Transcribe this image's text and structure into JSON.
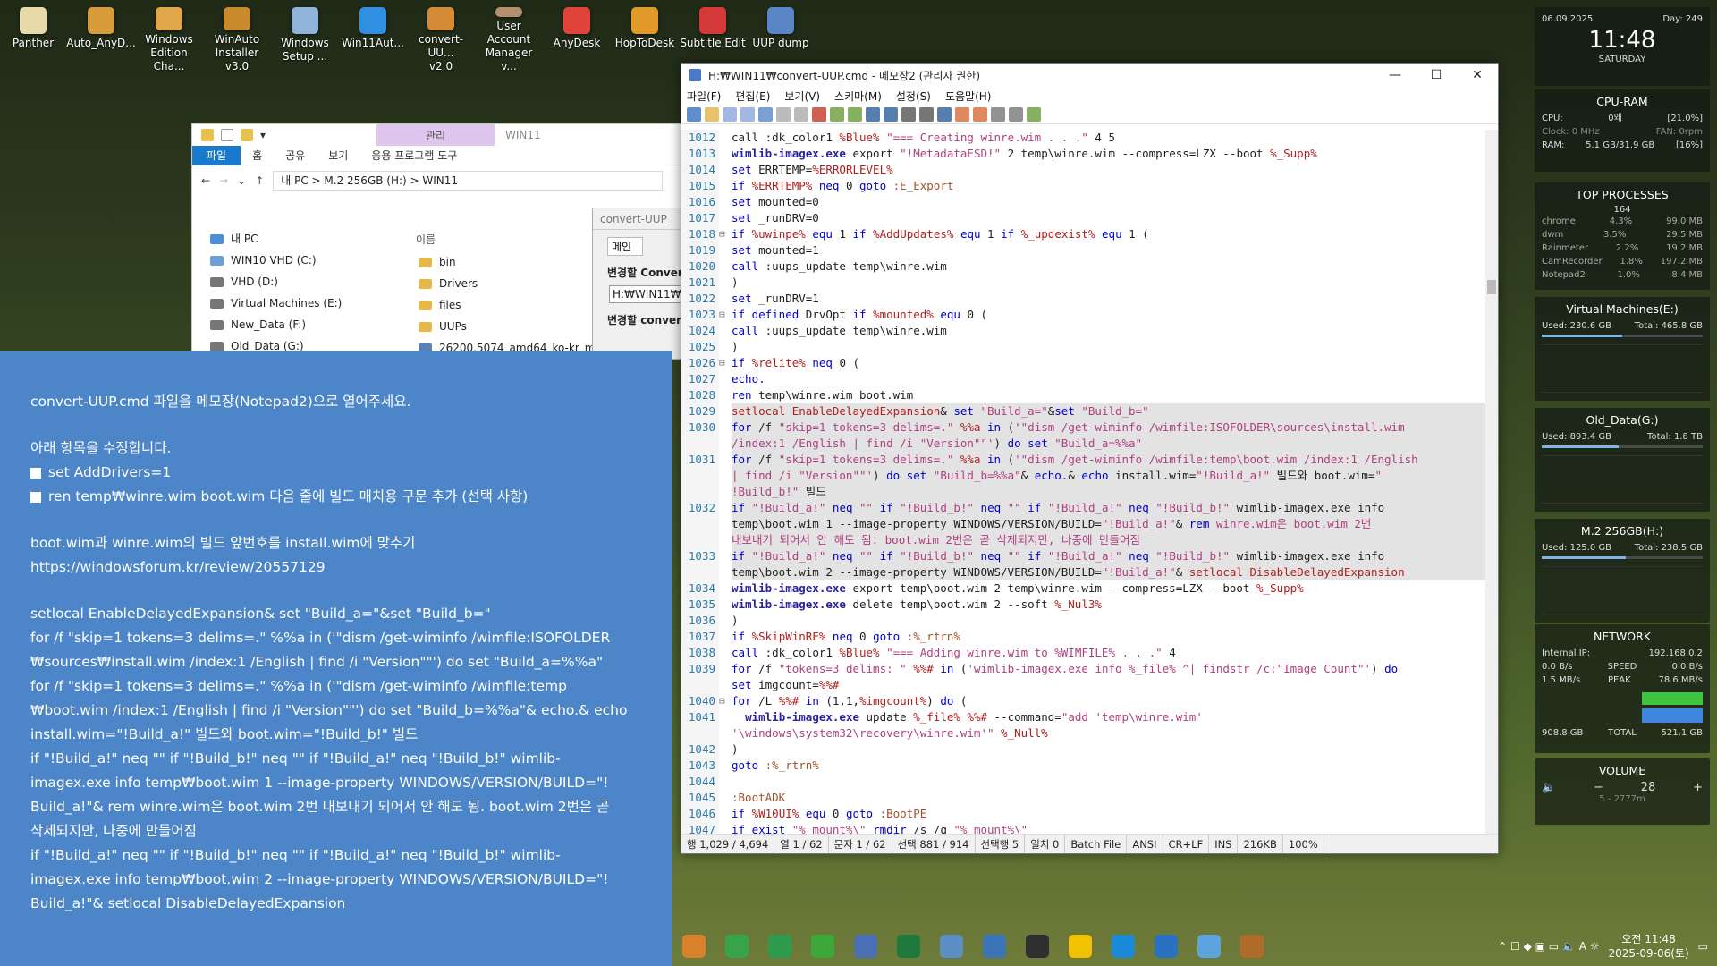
{
  "desktop_icons": [
    {
      "label": "Panther",
      "color": "#e8d9a8"
    },
    {
      "label": "Auto_AnyD...",
      "color": "#d79b3a"
    },
    {
      "label": "Windows\nEdition Cha...",
      "color": "#e0a64a"
    },
    {
      "label": "WinAuto\nInstaller v3.0",
      "color": "#c98a2e"
    },
    {
      "label": "Windows\nSetup ...",
      "color": "#8fb4d8"
    },
    {
      "label": "Win11Aut...",
      "color": "#2f8fe0"
    },
    {
      "label": "convert-UU...\nv2.0",
      "color": "#d58a35"
    },
    {
      "label": "User Account\nManager v...",
      "color": "#b58e6e"
    },
    {
      "label": "AnyDesk",
      "color": "#e0443b"
    },
    {
      "label": "HopToDesk",
      "color": "#e19a2a"
    },
    {
      "label": "Subtitle Edit",
      "color": "#d53a3a"
    },
    {
      "label": "UUP dump",
      "color": "#5a86c8"
    }
  ],
  "explorer": {
    "ribbon_context": "관리",
    "window_label": "WIN11",
    "tabs": [
      "파일",
      "홈",
      "공유",
      "보기",
      "응용 프로그램 도구"
    ],
    "path": [
      "내 PC",
      "M.2 256GB (H:)",
      "WIN11"
    ],
    "nav": [
      {
        "label": "내 PC",
        "color": "#4a90d9"
      },
      {
        "label": "WIN10 VHD (C:)",
        "color": "#6a9fd8"
      },
      {
        "label": "VHD (D:)",
        "color": "#777"
      },
      {
        "label": "Virtual Machines (E:)",
        "color": "#777"
      },
      {
        "label": "New_Data (F:)",
        "color": "#777"
      },
      {
        "label": "Old_Data (G:)",
        "color": "#777"
      }
    ],
    "column_header": "이름",
    "files": [
      {
        "label": "bin",
        "color": "#e6b84a"
      },
      {
        "label": "Drivers",
        "color": "#e6b84a"
      },
      {
        "label": "files",
        "color": "#e6b84a"
      },
      {
        "label": "UUPs",
        "color": "#e6b84a"
      },
      {
        "label": "26200.5074_amd64_ko-kr_multi",
        "color": "#5b7fb8"
      }
    ]
  },
  "convert_dialog": {
    "title": "convert-UUP_",
    "tab": "메인",
    "label1": "변경할 Conver",
    "field": "H:₩WIN11₩",
    "label2": "변경할 conver"
  },
  "notepad": {
    "title": "H:₩WIN11₩convert-UUP.cmd - 메모장2 (관리자 권한)",
    "menu": [
      "파일(F)",
      "편집(E)",
      "보기(V)",
      "스키마(M)",
      "설정(S)",
      "도움말(H)"
    ],
    "lines": [
      {
        "n": "1012",
        "html": "call :dk_color1 <span class=var>%Blue%</span> <span class=str>\"=== Creating winre.wim . . .\"</span> 4 5"
      },
      {
        "n": "1013",
        "html": "<span class=cmd>wimlib-imagex.exe</span> export <span class=str>\"!MetadataESD!\"</span> 2 temp\\winre.wim --compress=LZX --boot <span class=var>%_Supp%</span>"
      },
      {
        "n": "1014",
        "html": "<span class=kw>set</span> ERRTEMP=<span class=var>%ERRORLEVEL%</span>"
      },
      {
        "n": "1015",
        "html": "<span class=kw>if</span> <span class=var>%ERRTEMP%</span> <span class=kw>neq</span> 0 <span class=kw>goto</span> <span class=lbl>:E_Export</span>"
      },
      {
        "n": "1016",
        "html": "<span class=kw>set</span> mounted=0"
      },
      {
        "n": "1017",
        "html": "<span class=kw>set</span> _runDRV=0"
      },
      {
        "n": "1018",
        "fold": "⊟",
        "html": "<span class=kw>if</span> <span class=var>%uwinpe%</span> <span class=kw>equ</span> 1 <span class=kw>if</span> <span class=var>%AddUpdates%</span> <span class=kw>equ</span> 1 <span class=kw>if</span> <span class=var>%_updexist%</span> <span class=kw>equ</span> 1 ("
      },
      {
        "n": "1019",
        "html": "<span class=kw>set</span> mounted=1"
      },
      {
        "n": "1020",
        "html": "<span class=kw>call</span> :uups_update temp\\winre.wim"
      },
      {
        "n": "1021",
        "html": ")"
      },
      {
        "n": "1022",
        "html": "<span class=kw>set</span> _runDRV=1"
      },
      {
        "n": "1023",
        "fold": "⊟",
        "html": "<span class=kw>if defined</span> DrvOpt <span class=kw>if</span> <span class=var>%mounted%</span> <span class=kw>equ</span> 0 ("
      },
      {
        "n": "1024",
        "html": "<span class=kw>call</span> :uups_update temp\\winre.wim"
      },
      {
        "n": "1025",
        "html": ")"
      },
      {
        "n": "1026",
        "fold": "⊟",
        "html": "<span class=kw>if</span> <span class=var>%relite%</span> <span class=kw>neq</span> 0 ("
      },
      {
        "n": "1027",
        "html": "<span class=kw>echo.</span>"
      },
      {
        "n": "1028",
        "html": "<span class=kw>ren</span> temp\\winre.wim boot.wim"
      },
      {
        "n": "1029",
        "sel": true,
        "html": "<span class=var>setlocal EnableDelayedExpansion</span>&amp; <span class=kw>set</span> <span class=str>\"Build_a=\"</span>&amp;<span class=kw>set</span> <span class=str>\"Build_b=\"</span>"
      },
      {
        "n": "1030",
        "sel": true,
        "html": "<span class=kw>for</span> /f <span class=str>\"skip=1 tokens=3 delims=.\"</span> <span class=var>%%a</span> <span class=kw>in</span> (<span class=str>'\"dism /get-wiminfo /wimfile:ISOFOLDER\\sources\\install.wim</span>"
      },
      {
        "n": "",
        "sel": true,
        "html": "<span class=str>/index:1 /English | find /i \"Version\"\"'</span>) <span class=kw>do set</span> <span class=str>\"Build_a=%%a\"</span>"
      },
      {
        "n": "1031",
        "sel": true,
        "html": "<span class=kw>for</span> /f <span class=str>\"skip=1 tokens=3 delims=.\"</span> <span class=var>%%a</span> <span class=kw>in</span> (<span class=str>'\"dism /get-wiminfo /wimfile:temp\\boot.wim /index:1 /English</span>"
      },
      {
        "n": "",
        "sel": true,
        "html": "<span class=str>| find /i \"Version\"\"'</span>) <span class=kw>do set</span> <span class=str>\"Build_b=%%a\"</span>&amp; <span class=kw>echo.</span>&amp; <span class=kw>echo</span> install.wim=<span class=str>\"!Build_a!\"</span> 빌드와 boot.wim=<span class=str>\"</span>"
      },
      {
        "n": "",
        "sel": true,
        "html": "<span class=str>!Build_b!\"</span> 빌드"
      },
      {
        "n": "1032",
        "sel": true,
        "html": "<span class=kw>if</span> <span class=str>\"!Build_a!\"</span> <span class=kw>neq</span> <span class=str>\"\"</span> <span class=kw>if</span> <span class=str>\"!Build_b!\"</span> <span class=kw>neq</span> <span class=str>\"\"</span> <span class=kw>if</span> <span class=str>\"!Build_a!\"</span> <span class=kw>neq</span> <span class=str>\"!Build_b!\"</span> wimlib-imagex.exe info"
      },
      {
        "n": "",
        "sel": true,
        "html": "temp\\boot.wim 1 --image-property WINDOWS/VERSION/BUILD=<span class=str>\"!Build_a!\"</span>&amp; <span class=kw>rem</span> <span class=str>winre.wim은 boot.wim 2번</span>"
      },
      {
        "n": "",
        "sel": true,
        "html": "<span class=str>내보내기 되어서 안 해도 됨. boot.wim 2번은 곧 삭제되지만, 나중에 만들어짐</span>"
      },
      {
        "n": "1033",
        "sel": true,
        "html": "<span class=kw>if</span> <span class=str>\"!Build_a!\"</span> <span class=kw>neq</span> <span class=str>\"\"</span> <span class=kw>if</span> <span class=str>\"!Build_b!\"</span> <span class=kw>neq</span> <span class=str>\"\"</span> <span class=kw>if</span> <span class=str>\"!Build_a!\"</span> <span class=kw>neq</span> <span class=str>\"!Build_b!\"</span> wimlib-imagex.exe info"
      },
      {
        "n": "",
        "sel": true,
        "html": "temp\\boot.wim 2 --image-property WINDOWS/VERSION/BUILD=<span class=str>\"!Build_a!\"</span>&amp; <span class=var>setlocal DisableDelayedExpansion</span>"
      },
      {
        "n": "1034",
        "html": "<span class=cmd>wimlib-imagex.exe</span> export temp\\boot.wim 2 temp\\winre.wim --compress=LZX --boot <span class=var>%_Supp%</span>"
      },
      {
        "n": "1035",
        "html": "<span class=cmd>wimlib-imagex.exe</span> delete temp\\boot.wim 2 --soft <span class=var>%_Nul3%</span>"
      },
      {
        "n": "1036",
        "html": ")"
      },
      {
        "n": "1037",
        "html": "<span class=kw>if</span> <span class=var>%SkipWinRE%</span> <span class=kw>neq</span> 0 <span class=kw>goto</span> <span class=lbl>:%_rtrn%</span>"
      },
      {
        "n": "1038",
        "html": "<span class=kw>call</span> :dk_color1 <span class=var>%Blue%</span> <span class=str>\"=== Adding winre.wim to %WIMFILE% . . .\"</span> 4"
      },
      {
        "n": "1039",
        "html": "<span class=kw>for</span> /f <span class=str>\"tokens=3 delims: \"</span> <span class=var>%%#</span> <span class=kw>in</span> (<span class=str>'wimlib-imagex.exe info %_file% ^| findstr /c:\"Image Count\"'</span>) <span class=kw>do</span>"
      },
      {
        "n": "",
        "html": "<span class=kw>set</span> imgcount=<span class=var>%%#</span>"
      },
      {
        "n": "1040",
        "fold": "⊟",
        "html": "<span class=kw>for</span> /L <span class=var>%%#</span> <span class=kw>in</span> (1,1,<span class=var>%imgcount%</span>) <span class=kw>do</span> ("
      },
      {
        "n": "1041",
        "html": "  <span class=cmd>wimlib-imagex.exe</span> update <span class=var>%_file%</span> <span class=var>%%#</span> --command=<span class=str>\"add 'temp\\winre.wim'</span>"
      },
      {
        "n": "",
        "html": "<span class=str>'\\windows\\system32\\recovery\\winre.wim'\"</span> <span class=var>%_Null%</span>"
      },
      {
        "n": "1042",
        "html": ")"
      },
      {
        "n": "1043",
        "html": "<span class=kw>goto</span> <span class=lbl>:%_rtrn%</span>"
      },
      {
        "n": "1044",
        "html": ""
      },
      {
        "n": "1045",
        "html": "<span class=lbl>:BootADK</span>"
      },
      {
        "n": "1046",
        "html": "<span class=kw>if</span> <span class=var>%W10UI%</span> <span class=kw>equ</span> 0 <span class=kw>goto</span> <span class=lbl>:BootPE</span>"
      },
      {
        "n": "1047",
        "html": "<span class=kw>if exist</span> <span class=str>\"%_mount%\\\"</span> <span class=kw>rmdir</span> /s /q <span class=str>\"%_mount%\\\"</span>"
      }
    ],
    "status": [
      "행 1,029 / 4,694",
      "열 1 / 62",
      "문자 1 / 62",
      "선택 881 / 914",
      "선택행 5",
      "일치 0",
      "Batch File",
      "ANSI",
      "CR+LF",
      "INS",
      "216KB",
      "100%"
    ]
  },
  "note": {
    "p1": "convert-UUP.cmd 파일을 메모장(Notepad2)으로 열어주세요.",
    "p2": "아래 항목을 수정합니다.",
    "c1": "set AddDrivers=1",
    "c2": "ren temp₩winre.wim boot.wim 다음 줄에 빌드 매치용 구문 추가 (선택 사항)",
    "p3": "boot.wim과 winre.wim의 빌드 앞번호를 install.wim에 맞추기",
    "p4": "https://windowsforum.kr/review/20557129",
    "code": [
      "setlocal EnableDelayedExpansion& set \"Build_a=\"&set \"Build_b=\"",
      "for /f \"skip=1 tokens=3 delims=.\" %%a in ('\"dism /get-wiminfo /wimfile:ISOFOLDER",
      "₩sources₩install.wim /index:1 /English | find /i \"Version\"\"') do set \"Build_a=%%a\"",
      "for /f \"skip=1 tokens=3 delims=.\" %%a in ('\"dism /get-wiminfo /wimfile:temp",
      "₩boot.wim /index:1 /English | find /i \"Version\"\"') do set \"Build_b=%%a\"& echo.& echo",
      "install.wim=\"!Build_a!\" 빌드와 boot.wim=\"!Build_b!\" 빌드",
      "if \"!Build_a!\" neq \"\" if \"!Build_b!\" neq \"\" if \"!Build_a!\" neq \"!Build_b!\" wimlib-",
      "imagex.exe info temp₩boot.wim 1 --image-property WINDOWS/VERSION/BUILD=\"!",
      "Build_a!\"& rem winre.wim은 boot.wim 2번 내보내기 되어서 안 해도 됨. boot.wim 2번은 곧",
      "삭제되지만, 나중에 만들어짐",
      "if \"!Build_a!\" neq \"\" if \"!Build_b!\" neq \"\" if \"!Build_a!\" neq \"!Build_b!\" wimlib-",
      "imagex.exe info temp₩boot.wim 2 --image-property WINDOWS/VERSION/BUILD=\"!",
      "Build_a!\"& setlocal DisableDelayedExpansion"
    ]
  },
  "widgets": {
    "date": "06.09.2025",
    "day": "Day: 249",
    "time": "11:48",
    "weekday": "SATURDAY",
    "cpuram_title": "CPU-RAM",
    "cpu_label": "CPU:",
    "cpu_val": "0왜",
    "cpu_pct": "[21.0%]",
    "clock": "Clock: 0 MHz",
    "fan": "FAN: 0rpm",
    "ram_label": "RAM:",
    "ram_val": "5.1 GB/31.9 GB",
    "ram_pct": "[16%]",
    "top_title": "TOP PROCESSES",
    "top_count": "164",
    "procs": [
      [
        "chrome",
        "4.3%",
        "99.0 MB"
      ],
      [
        "dwm",
        "3.5%",
        "29.5 MB"
      ],
      [
        "Rainmeter",
        "2.2%",
        "19.2 MB"
      ],
      [
        "CamRecorder",
        "1.8%",
        "197.2 MB"
      ],
      [
        "Notepad2",
        "1.0%",
        "8.4 MB"
      ]
    ],
    "drives": [
      {
        "title": "Virtual Machines(E:)",
        "used": "Used: 230.6 GB",
        "total": "Total: 465.8 GB",
        "fill": 0.5
      },
      {
        "title": "Old_Data(G:)",
        "used": "Used: 893.4 GB",
        "total": "Total: 1.8 TB",
        "fill": 0.48
      },
      {
        "title": "M.2 256GB(H:)",
        "used": "Used: 125.0 GB",
        "total": "Total: 238.5 GB",
        "fill": 0.52
      }
    ],
    "net_title": "NETWORK",
    "ip_label": "Internal IP:",
    "ip": "192.168.0.2",
    "down": "0.0 B/s",
    "speed": "SPEED",
    "up": "0.0 B/s",
    "down2": "1.5 MB/s",
    "peak": "PEAK",
    "up2": "78.6 MB/s",
    "tot_l": "908.8 GB",
    "total": "TOTAL",
    "tot_r": "521.1 GB",
    "vol_title": "VOLUME",
    "vol": "28",
    "vol_sub": "5 - 2777m"
  },
  "taskbar": {
    "icons": [
      "#d9822b",
      "#37a34a",
      "#2e9b4e",
      "#3ca83a",
      "#4a6fb5",
      "#1e7a3c",
      "#5b8ec4",
      "#3c74b8",
      "#2f2f2f",
      "#f2c200",
      "#1b8ad8",
      "#2a72c0",
      "#5ba4dd",
      "#b06a2a"
    ],
    "time": "오전 11:48",
    "date": "2025-09-06(토)"
  }
}
